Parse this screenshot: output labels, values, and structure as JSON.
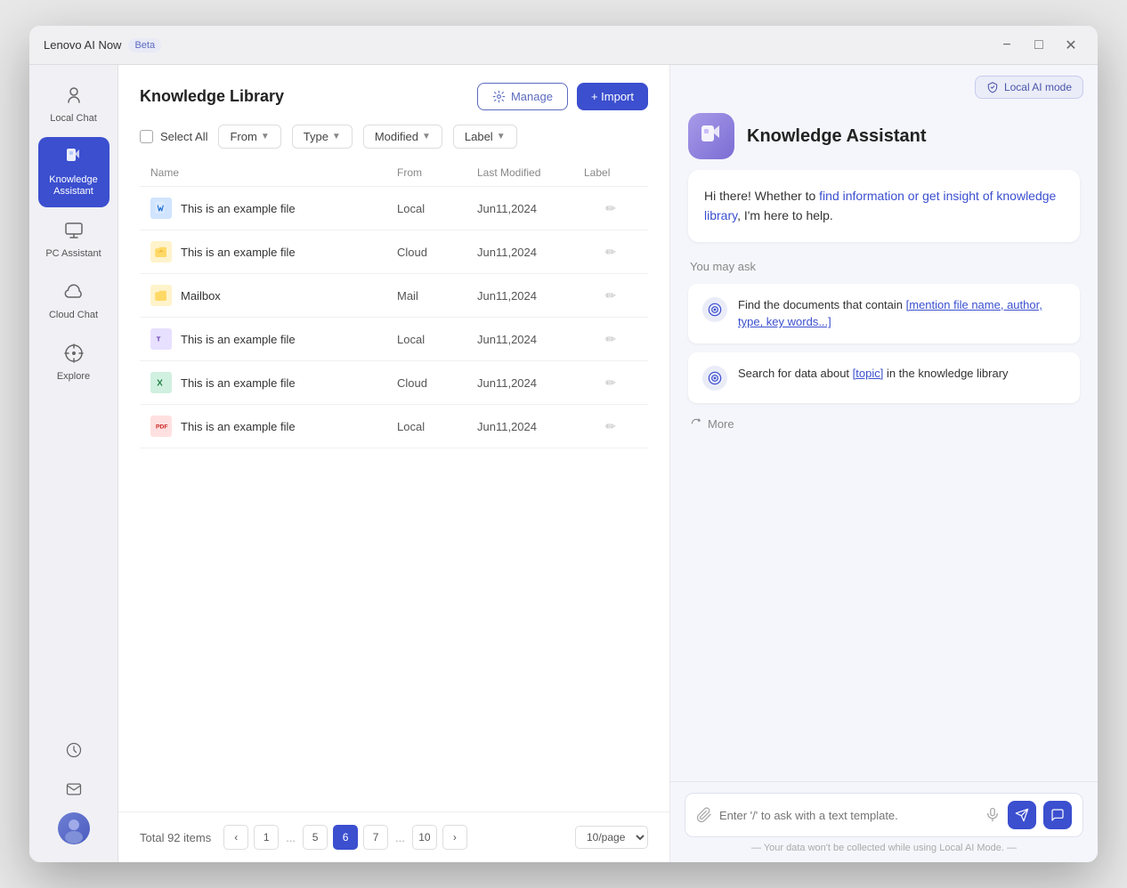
{
  "app": {
    "title": "Lenovo AI Now",
    "beta_label": "Beta"
  },
  "window_controls": {
    "minimize": "−",
    "maximize": "□",
    "close": "✕"
  },
  "sidebar": {
    "items": [
      {
        "id": "local-chat",
        "label": "Local Chat",
        "icon": "💬",
        "active": false
      },
      {
        "id": "knowledge-assistant",
        "label": "Knowledge\nAssistant",
        "icon": "📘",
        "active": true
      },
      {
        "id": "pc-assistant",
        "label": "PC Assistant",
        "icon": "💻",
        "active": false
      },
      {
        "id": "cloud-chat",
        "label": "Cloud Chat",
        "icon": "☁",
        "active": false
      },
      {
        "id": "explore",
        "label": "Explore",
        "icon": "🔍",
        "active": false
      }
    ],
    "bottom_icons": [
      {
        "id": "history",
        "icon": "🕐"
      },
      {
        "id": "mail",
        "icon": "✉"
      }
    ]
  },
  "library": {
    "title": "Knowledge Library",
    "manage_label": "Manage",
    "import_label": "+ Import",
    "select_all_label": "Select All",
    "filters": {
      "from_label": "From",
      "type_label": "Type",
      "modified_label": "Modified",
      "label_label": "Label"
    },
    "table": {
      "headers": [
        "Name",
        "From",
        "Last Modified",
        "Label"
      ],
      "rows": [
        {
          "name": "This is an example file",
          "type": "word",
          "from": "Local",
          "modified": "Jun11,2024",
          "icon": "W"
        },
        {
          "name": "This is an example file",
          "type": "folder-cloud",
          "from": "Cloud",
          "modified": "Jun11,2024",
          "icon": "📁"
        },
        {
          "name": "Mailbox",
          "type": "folder-mail",
          "from": "Mail",
          "modified": "Jun11,2024",
          "icon": "📁"
        },
        {
          "name": "This is an example file",
          "type": "teams",
          "from": "Local",
          "modified": "Jun11,2024",
          "icon": "T"
        },
        {
          "name": "This is an example file",
          "type": "excel",
          "from": "Cloud",
          "modified": "Jun11,2024",
          "icon": "X"
        },
        {
          "name": "This is an example file",
          "type": "pdf",
          "from": "Local",
          "modified": "Jun11,2024",
          "icon": "P"
        }
      ]
    },
    "pagination": {
      "total_label": "Total 92 items",
      "pages": [
        "1",
        "...",
        "5",
        "6",
        "7",
        "...",
        "10"
      ],
      "current_page": "6",
      "page_size_label": "10/page"
    }
  },
  "assistant": {
    "local_ai_label": "Local AI mode",
    "name": "Knowledge Assistant",
    "greeting": "Hi there! Whether to find information or get insight of knowledge library, I'm here to help.",
    "greeting_link1": "find information or get insight of",
    "greeting_link2": "knowledge library",
    "you_may_ask": "You may ask",
    "suggestions": [
      {
        "text": "Find the documents that contain [mention file name, author, type, key words...]",
        "link_text": "[mention file name, author, type, key words...]"
      },
      {
        "text": "Search for data about [topic] in the knowledge library",
        "link_text": "[topic]"
      }
    ],
    "more_label": "More",
    "input_placeholder": "Enter '/' to ask with a text template.",
    "privacy_note": "— Your data won't be collected while using Local AI Mode. —"
  }
}
